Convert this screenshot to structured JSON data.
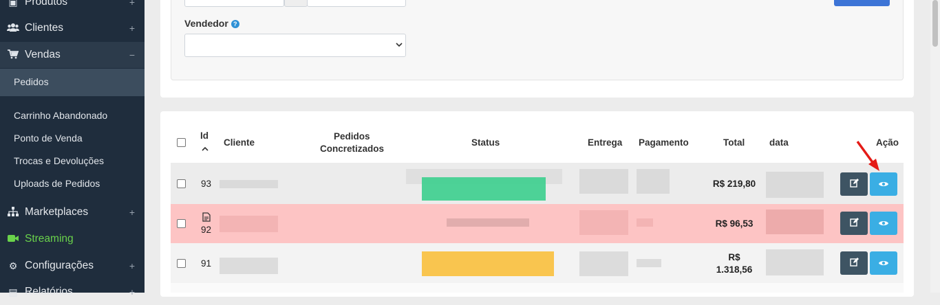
{
  "sidebar": {
    "produtos": "Produtos",
    "clientes": "Clientes",
    "vendas": "Vendas",
    "pedidos": "Pedidos",
    "carrinho": "Carrinho Abandonado",
    "ponto": "Ponto de Venda",
    "trocas": "Trocas e Devoluções",
    "uploads": "Uploads de Pedidos",
    "marketplaces": "Marketplaces",
    "streaming": "Streaming",
    "configuracoes": "Configurações",
    "relatorios": "Relatórios",
    "plus": "+",
    "minus": "−"
  },
  "filters": {
    "vendedor_label": "Vendedor",
    "help": "?"
  },
  "table": {
    "headers": {
      "id": "Id",
      "sort": "^",
      "cliente": "Cliente",
      "pedidos1": "Pedidos",
      "pedidos2": "Concretizados",
      "status": "Status",
      "entrega": "Entrega",
      "pagamento": "Pagamento",
      "total": "Total",
      "data": "data",
      "acao": "Ação"
    },
    "rows": [
      {
        "id": "93",
        "total": "R$ 219,80"
      },
      {
        "id": "92",
        "total": "R$ 96,53"
      },
      {
        "id": "91",
        "total_line1": "R$",
        "total_line2": "1.318,56"
      }
    ]
  },
  "colors": {
    "sidebar": "#1f2d3d",
    "row_highlight": "#fdc4c4",
    "status_green": "#3ccf8e",
    "status_yellow": "#f9c03d",
    "view_button": "#3aaee4",
    "edit_button": "#3e5463",
    "annotation_arrow": "#e41b17"
  }
}
